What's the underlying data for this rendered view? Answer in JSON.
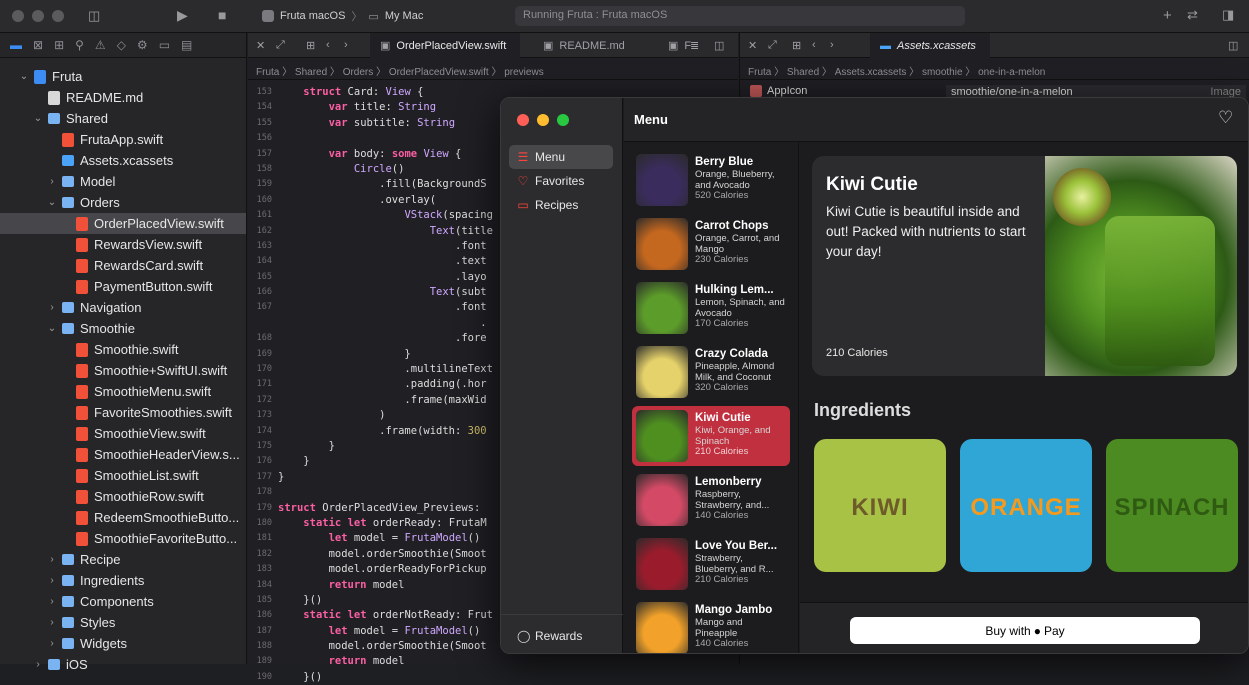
{
  "toolbar": {
    "scheme": "Fruta macOS",
    "destination": "My Mac",
    "status": "Running Fruta : Fruta macOS"
  },
  "navigator": {
    "items": [
      {
        "label": "Fruta",
        "indent": 0,
        "icon": "project",
        "chevron": "v"
      },
      {
        "label": "README.md",
        "indent": 1,
        "icon": "doc",
        "chevron": ""
      },
      {
        "label": "Shared",
        "indent": 1,
        "icon": "folder",
        "chevron": "v"
      },
      {
        "label": "FrutaApp.swift",
        "indent": 2,
        "icon": "swift",
        "chevron": ""
      },
      {
        "label": "Assets.xcassets",
        "indent": 2,
        "icon": "assets",
        "chevron": ""
      },
      {
        "label": "Model",
        "indent": 2,
        "icon": "folder",
        "chevron": ">"
      },
      {
        "label": "Orders",
        "indent": 2,
        "icon": "folder",
        "chevron": "v"
      },
      {
        "label": "OrderPlacedView.swift",
        "indent": 3,
        "icon": "swift",
        "chevron": "",
        "selected": true
      },
      {
        "label": "RewardsView.swift",
        "indent": 3,
        "icon": "swift",
        "chevron": ""
      },
      {
        "label": "RewardsCard.swift",
        "indent": 3,
        "icon": "swift",
        "chevron": ""
      },
      {
        "label": "PaymentButton.swift",
        "indent": 3,
        "icon": "swift",
        "chevron": ""
      },
      {
        "label": "Navigation",
        "indent": 2,
        "icon": "folder",
        "chevron": ">"
      },
      {
        "label": "Smoothie",
        "indent": 2,
        "icon": "folder",
        "chevron": "v"
      },
      {
        "label": "Smoothie.swift",
        "indent": 3,
        "icon": "swift",
        "chevron": ""
      },
      {
        "label": "Smoothie+SwiftUI.swift",
        "indent": 3,
        "icon": "swift",
        "chevron": ""
      },
      {
        "label": "SmoothieMenu.swift",
        "indent": 3,
        "icon": "swift",
        "chevron": ""
      },
      {
        "label": "FavoriteSmoothies.swift",
        "indent": 3,
        "icon": "swift",
        "chevron": ""
      },
      {
        "label": "SmoothieView.swift",
        "indent": 3,
        "icon": "swift",
        "chevron": ""
      },
      {
        "label": "SmoothieHeaderView.s...",
        "indent": 3,
        "icon": "swift",
        "chevron": ""
      },
      {
        "label": "SmoothieList.swift",
        "indent": 3,
        "icon": "swift",
        "chevron": ""
      },
      {
        "label": "SmoothieRow.swift",
        "indent": 3,
        "icon": "swift",
        "chevron": ""
      },
      {
        "label": "RedeemSmoothieButto...",
        "indent": 3,
        "icon": "swift",
        "chevron": ""
      },
      {
        "label": "SmoothieFavoriteButto...",
        "indent": 3,
        "icon": "swift",
        "chevron": ""
      },
      {
        "label": "Recipe",
        "indent": 2,
        "icon": "folder",
        "chevron": ">"
      },
      {
        "label": "Ingredients",
        "indent": 2,
        "icon": "folder",
        "chevron": ">"
      },
      {
        "label": "Components",
        "indent": 2,
        "icon": "folder",
        "chevron": ">"
      },
      {
        "label": "Styles",
        "indent": 2,
        "icon": "folder",
        "chevron": ">"
      },
      {
        "label": "Widgets",
        "indent": 2,
        "icon": "folder",
        "chevron": ">"
      },
      {
        "label": "iOS",
        "indent": 1,
        "icon": "folder",
        "chevron": ">"
      }
    ]
  },
  "editor": {
    "tabs": [
      "OrderPlacedView.swift",
      "README.md",
      "F"
    ],
    "breadcrumb": "Fruta 〉 Shared 〉 Orders 〉 OrderPlacedView.swift 〉 previews",
    "lines": [
      {
        "n": "153",
        "t": "    struct Card: View {"
      },
      {
        "n": "154",
        "t": "        var title: String"
      },
      {
        "n": "155",
        "t": "        var subtitle: String"
      },
      {
        "n": "156",
        "t": ""
      },
      {
        "n": "157",
        "t": "        var body: some View {"
      },
      {
        "n": "158",
        "t": "            Circle()"
      },
      {
        "n": "159",
        "t": "                .fill(BackgroundS"
      },
      {
        "n": "160",
        "t": "                .overlay("
      },
      {
        "n": "161",
        "t": "                    VStack(spacing"
      },
      {
        "n": "162",
        "t": "                        Text(title"
      },
      {
        "n": "163",
        "t": "                            .font"
      },
      {
        "n": "164",
        "t": "                            .text"
      },
      {
        "n": "165",
        "t": "                            .layo"
      },
      {
        "n": "166",
        "t": "                        Text(subt"
      },
      {
        "n": "167",
        "t": "                            .font"
      },
      {
        "n": "",
        "t": "                                ."
      },
      {
        "n": "168",
        "t": "                            .fore"
      },
      {
        "n": "169",
        "t": "                    }"
      },
      {
        "n": "170",
        "t": "                    .multilineText"
      },
      {
        "n": "171",
        "t": "                    .padding(.hor"
      },
      {
        "n": "172",
        "t": "                    .frame(maxWid"
      },
      {
        "n": "173",
        "t": "                )"
      },
      {
        "n": "174",
        "t": "                .frame(width: 300"
      },
      {
        "n": "175",
        "t": "        }"
      },
      {
        "n": "176",
        "t": "    }"
      },
      {
        "n": "177",
        "t": "}"
      },
      {
        "n": "178",
        "t": ""
      },
      {
        "n": "179",
        "t": "struct OrderPlacedView_Previews: "
      },
      {
        "n": "180",
        "t": "    static let orderReady: FrutaM"
      },
      {
        "n": "181",
        "t": "        let model = FrutaModel()"
      },
      {
        "n": "182",
        "t": "        model.orderSmoothie(Smoot"
      },
      {
        "n": "183",
        "t": "        model.orderReadyForPickup"
      },
      {
        "n": "184",
        "t": "        return model"
      },
      {
        "n": "185",
        "t": "    }()"
      },
      {
        "n": "186",
        "t": "    static let orderNotReady: Frut"
      },
      {
        "n": "187",
        "t": "        let model = FrutaModel()"
      },
      {
        "n": "188",
        "t": "        model.orderSmoothie(Smoot"
      },
      {
        "n": "189",
        "t": "        return model"
      },
      {
        "n": "190",
        "t": "    }()"
      }
    ]
  },
  "right_editor": {
    "tab": "Assets.xcassets",
    "breadcrumb": "Fruta 〉 Shared 〉 Assets.xcassets 〉 smoothie 〉 one-in-a-melon",
    "asset": "AppIcon",
    "field": "smoothie/one-in-a-melon",
    "field_hint": "Image"
  },
  "app": {
    "title": "Menu",
    "sidebar": [
      {
        "label": "Menu",
        "icon": "☰"
      },
      {
        "label": "Favorites",
        "icon": "♡"
      },
      {
        "label": "Recipes",
        "icon": "▭"
      }
    ],
    "rewards_label": "Rewards",
    "menu": [
      {
        "name": "Berry Blue",
        "desc": "Orange, Blueberry, and Avocado",
        "cal": "520 Calories",
        "color": "#3a2c5c"
      },
      {
        "name": "Carrot Chops",
        "desc": "Orange, Carrot, and Mango",
        "cal": "230 Calories",
        "color": "#c4671f"
      },
      {
        "name": "Hulking Lem...",
        "desc": "Lemon, Spinach, and Avocado",
        "cal": "170 Calories",
        "color": "#5c9c2a"
      },
      {
        "name": "Crazy Colada",
        "desc": "Pineapple, Almond Milk, and Coconut",
        "cal": "320 Calories",
        "color": "#e6d26a"
      },
      {
        "name": "Kiwi Cutie",
        "desc": "Kiwi, Orange, and Spinach",
        "cal": "210 Calories",
        "color": "#4f8f20"
      },
      {
        "name": "Lemonberry",
        "desc": "Raspberry, Strawberry, and...",
        "cal": "140 Calories",
        "color": "#d44a66"
      },
      {
        "name": "Love You Ber...",
        "desc": "Strawberry, Blueberry, and R...",
        "cal": "210 Calories",
        "color": "#9a1c2c"
      },
      {
        "name": "Mango Jambo",
        "desc": "Mango and Pineapple",
        "cal": "140 Calories",
        "color": "#f2a22a"
      }
    ],
    "detail": {
      "title": "Kiwi Cutie",
      "description": "Kiwi Cutie is beautiful inside and out! Packed with nutrients to start your day!",
      "calories": "210 Calories",
      "ingredients_heading": "Ingredients",
      "ingredients": [
        {
          "label": "KIWI",
          "bg": "#a8c246",
          "fg": "#6e5b2a"
        },
        {
          "label": "ORANGE",
          "bg": "#2fa6d6",
          "fg": "#f59a1c"
        },
        {
          "label": "SPINACH",
          "bg": "#4c8a22",
          "fg": "#2f5a12"
        }
      ],
      "buy_label": "Buy with",
      "pay_label": "Pay"
    }
  }
}
